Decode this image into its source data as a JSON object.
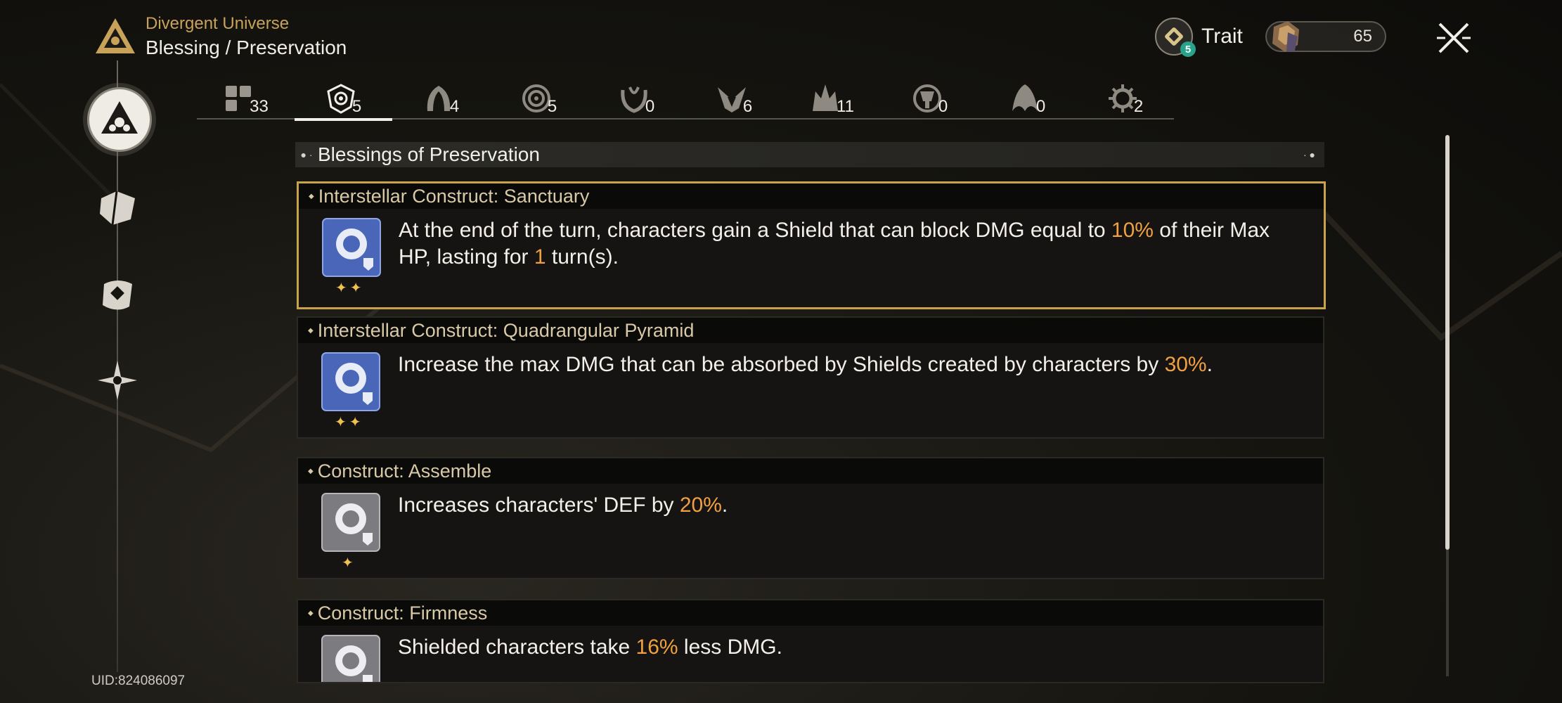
{
  "header": {
    "breadcrumb_top": "Divergent Universe",
    "title": "Blessing / Preservation",
    "trait_label": "Trait",
    "trait_badge": "5",
    "currency_value": "65"
  },
  "tabs": [
    {
      "icon": "all-blessings-icon",
      "count": "33"
    },
    {
      "icon": "preservation-path-icon",
      "count": "5",
      "active": true
    },
    {
      "icon": "remembrance-path-icon",
      "count": "4"
    },
    {
      "icon": "nihility-path-icon",
      "count": "5"
    },
    {
      "icon": "abundance-path-icon",
      "count": "0"
    },
    {
      "icon": "the-hunt-path-icon",
      "count": "6"
    },
    {
      "icon": "destruction-path-icon",
      "count": "11"
    },
    {
      "icon": "elation-path-icon",
      "count": "0"
    },
    {
      "icon": "propagation-path-icon",
      "count": "0"
    },
    {
      "icon": "erudition-path-icon",
      "count": "2"
    }
  ],
  "list": {
    "header": "Blessings of Preservation",
    "items": [
      {
        "name": "Interstellar Construct: Sanctuary",
        "stars": "✦✦",
        "desc_pre": "At the end of the turn, characters gain a Shield that can block DMG equal to ",
        "desc_hl1": "10%",
        "desc_mid": " of their Max HP, lasting for ",
        "desc_hl2": "1",
        "desc_post": " turn(s).",
        "rarity": "rare",
        "selected": true
      },
      {
        "name": "Interstellar Construct: Quadrangular Pyramid",
        "stars": "✦✦",
        "desc_pre": "Increase the max DMG that can be absorbed by Shields created by characters by ",
        "desc_hl1": "30%",
        "desc_post": ".",
        "rarity": "rare"
      },
      {
        "name": "Construct: Assemble",
        "stars": "✦",
        "desc_pre": "Increases characters' DEF by ",
        "desc_hl1": "20%",
        "desc_post": ".",
        "rarity": "common"
      },
      {
        "name": "Construct: Firmness",
        "stars": "✦",
        "desc_pre": "Shielded characters take ",
        "desc_hl1": "16%",
        "desc_post": " less DMG.",
        "rarity": "common"
      }
    ]
  },
  "footer": {
    "uid": "UID:824086097"
  },
  "colors": {
    "accent_gold": "#c9a24c",
    "highlight_orange": "#f0a040",
    "rare_icon_blue": "#4a66b8",
    "common_icon_gray": "#7b7b80"
  }
}
